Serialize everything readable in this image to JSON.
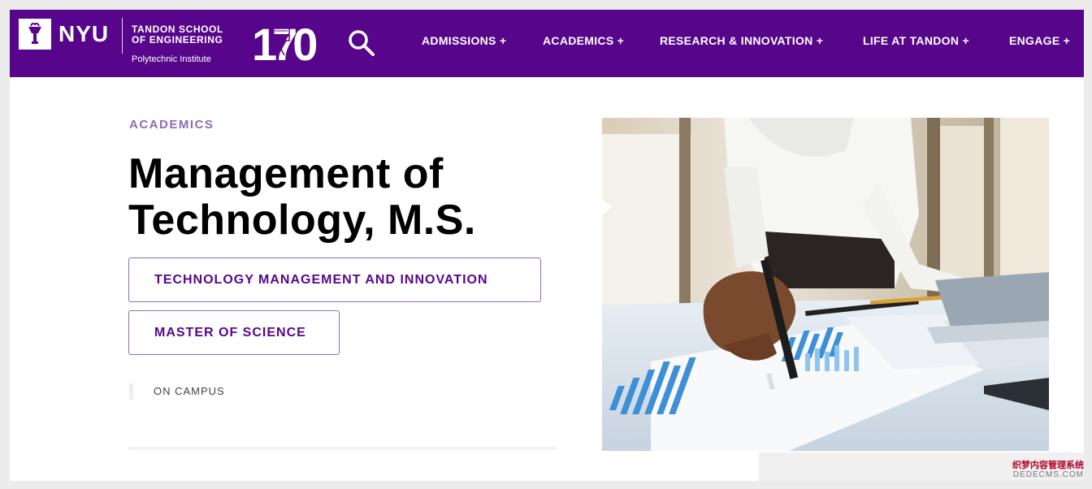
{
  "header": {
    "nyu_label": "NYU",
    "school_line1": "TANDON SCHOOL",
    "school_line2": "OF ENGINEERING",
    "school_subtitle": "Polytechnic Institute",
    "anniversary_text": "170",
    "brand_color": "#57068c"
  },
  "nav": {
    "items": [
      {
        "label": "ADMISSIONS +"
      },
      {
        "label": "ACADEMICS +"
      },
      {
        "label": "RESEARCH & INNOVATION +"
      },
      {
        "label": "LIFE AT TANDON +"
      },
      {
        "label": "ENGAGE +"
      }
    ],
    "search_icon": "search-icon"
  },
  "main": {
    "eyebrow": "ACADEMICS",
    "title_line1": "Management of",
    "title_line2": "Technology, M.S.",
    "tags": [
      {
        "label": "TECHNOLOGY MANAGEMENT AND INNOVATION"
      },
      {
        "label": "MASTER OF SCIENCE"
      }
    ],
    "campus": "ON CAMPUS",
    "accent_color": "#8e6bb8"
  },
  "watermark": {
    "line1": "织梦内容管理系统",
    "line2": "DEDECMS.COM"
  }
}
